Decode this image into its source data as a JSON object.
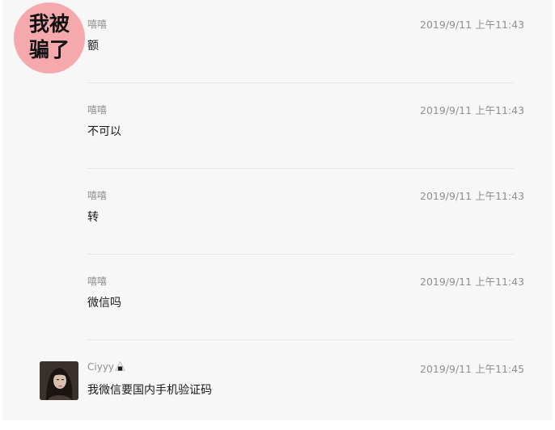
{
  "messages": [
    {
      "sender": "嘻嘻",
      "time": "2019/9/11 上午11:43",
      "text": "额"
    },
    {
      "sender": "嘻嘻",
      "time": "2019/9/11 上午11:43",
      "text": "不可以"
    },
    {
      "sender": "嘻嘻",
      "time": "2019/9/11 上午11:43",
      "text": "转"
    },
    {
      "sender": "嘻嘻",
      "time": "2019/9/11 上午11:43",
      "text": "微信吗"
    },
    {
      "sender": "Ciyyy",
      "sender_emoji": "rice-ball-icon",
      "time": "2019/9/11 上午11:45",
      "text": "我微信要国内手机验证码"
    }
  ],
  "sticker": {
    "line1": "我被",
    "line2": "骗了",
    "color": "#f6a9ac"
  }
}
